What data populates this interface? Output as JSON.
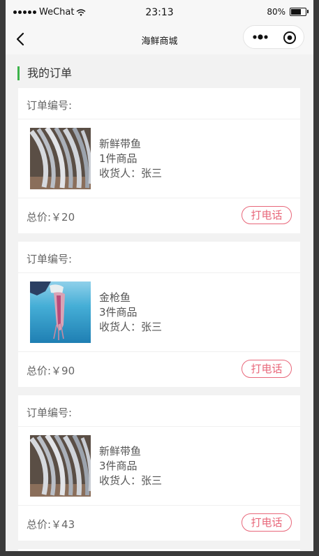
{
  "status_bar": {
    "carrier": "WeChat",
    "time": "23:13",
    "battery": "80%",
    "battery_level": 0.8
  },
  "nav": {
    "title": "海鲜商城"
  },
  "section": {
    "title": "我的订单"
  },
  "orders": [
    {
      "order_label": "订单编号:",
      "name": "新鲜带鱼",
      "count": "1件商品",
      "receiver": "收货人：张三",
      "total": "总价:￥20",
      "call_label": "打电话",
      "image": "hairtail-fish"
    },
    {
      "order_label": "订单编号:",
      "name": "金枪鱼",
      "count": "3件商品",
      "receiver": "收货人：张三",
      "total": "总价:￥90",
      "call_label": "打电话",
      "image": "squid-sea"
    },
    {
      "order_label": "订单编号:",
      "name": "新鲜带鱼",
      "count": "3件商品",
      "receiver": "收货人：张三",
      "total": "总价:￥43",
      "call_label": "打电话",
      "image": "hairtail-fish"
    }
  ],
  "colors": {
    "accent_green": "#3cb34a",
    "call_red": "#e8677a",
    "background": "#f2f2f2"
  }
}
